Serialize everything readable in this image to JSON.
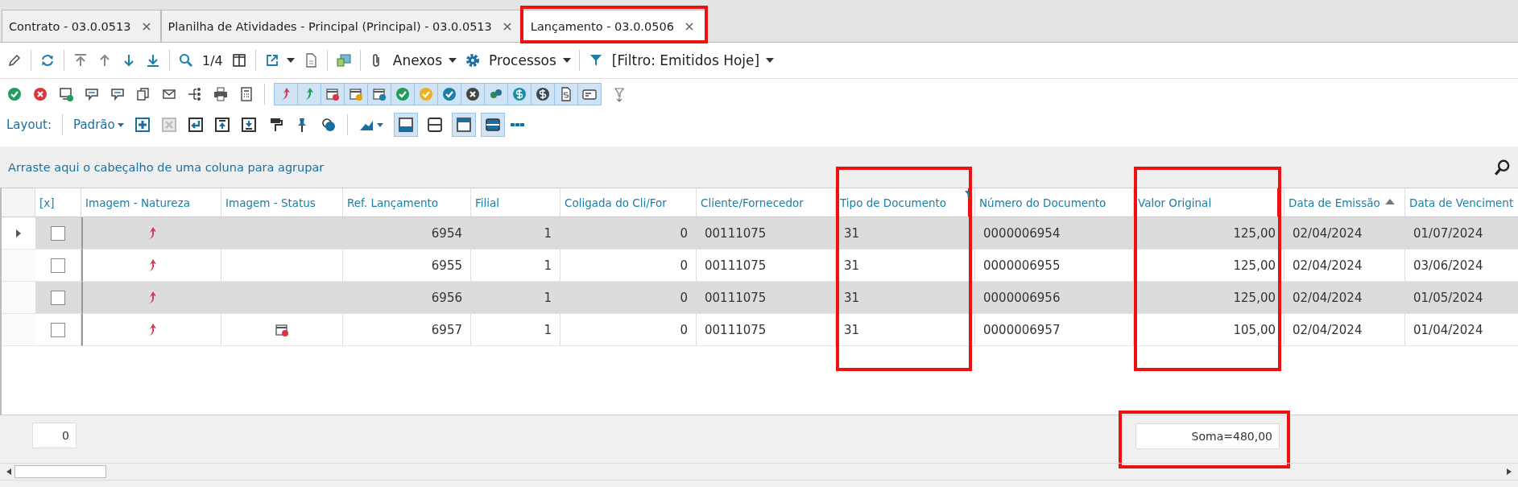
{
  "tabs": [
    {
      "label": "Contrato - 03.0.0513",
      "selected": false,
      "highlighted": false
    },
    {
      "label": "Planilha de Atividades - Principal (Principal) - 03.0.0513",
      "selected": false,
      "highlighted": false
    },
    {
      "label": "Lançamento - 03.0.0506",
      "selected": true,
      "highlighted": true
    }
  ],
  "toolbar": {
    "page": "1/4",
    "attachments": "Anexos",
    "processes": "Processos",
    "filter": "[Filtro: Emitidos Hoje]"
  },
  "layout_bar": {
    "label": "Layout:",
    "layout": "Padrão",
    "view_toggles": [
      {
        "pressed": true
      },
      {
        "pressed": false
      },
      {
        "pressed": true
      },
      {
        "pressed": true
      }
    ]
  },
  "group_panel": {
    "hint": "Arraste aqui o cabeçalho de uma coluna para agrupar"
  },
  "table": {
    "columns": [
      {
        "label": "[x]",
        "sorted_ascending": false,
        "filtered": false,
        "highlighted": false
      },
      {
        "label": "Imagem - Natureza",
        "sorted_ascending": false,
        "filtered": false,
        "highlighted": false
      },
      {
        "label": "Imagem - Status",
        "sorted_ascending": false,
        "filtered": false,
        "highlighted": false
      },
      {
        "label": "Ref. Lançamento",
        "sorted_ascending": false,
        "filtered": false,
        "highlighted": false
      },
      {
        "label": "Filial",
        "sorted_ascending": false,
        "filtered": false,
        "highlighted": false
      },
      {
        "label": "Coligada do Cli/For",
        "sorted_ascending": false,
        "filtered": false,
        "highlighted": false
      },
      {
        "label": "Cliente/Fornecedor",
        "sorted_ascending": false,
        "filtered": false,
        "highlighted": false
      },
      {
        "label": "Tipo de Documento",
        "sorted_ascending": false,
        "filtered": true,
        "highlighted": true
      },
      {
        "label": "Número do Documento",
        "sorted_ascending": false,
        "filtered": false,
        "highlighted": false
      },
      {
        "label": "Valor Original",
        "sorted_ascending": false,
        "filtered": false,
        "highlighted": true
      },
      {
        "label": "Data de Emissão",
        "sorted_ascending": true,
        "filtered": false,
        "highlighted": false
      },
      {
        "label": "Data de Venciment",
        "sorted_ascending": false,
        "filtered": false,
        "highlighted": false
      }
    ],
    "rows": [
      {
        "current": true,
        "checked": false,
        "has_status": false,
        "cells": [
          "",
          "",
          "",
          "6954",
          "1",
          "0",
          "00111075",
          "31",
          "0000006954",
          "125,00",
          "02/04/2024",
          "01/07/2024"
        ]
      },
      {
        "current": false,
        "checked": false,
        "has_status": false,
        "cells": [
          "",
          "",
          "",
          "6955",
          "1",
          "0",
          "00111075",
          "31",
          "0000006955",
          "125,00",
          "02/04/2024",
          "03/06/2024"
        ]
      },
      {
        "current": false,
        "checked": false,
        "has_status": false,
        "cells": [
          "",
          "",
          "",
          "6956",
          "1",
          "0",
          "00111075",
          "31",
          "0000006956",
          "125,00",
          "02/04/2024",
          "01/05/2024"
        ]
      },
      {
        "current": false,
        "checked": false,
        "has_status": true,
        "cells": [
          "",
          "",
          "",
          "6957",
          "1",
          "0",
          "00111075",
          "31",
          "0000006957",
          "105,00",
          "02/04/2024",
          "01/04/2024"
        ]
      }
    ]
  },
  "footer": {
    "count": "0",
    "sum": "Soma=480,00",
    "sum_highlighted": true
  }
}
